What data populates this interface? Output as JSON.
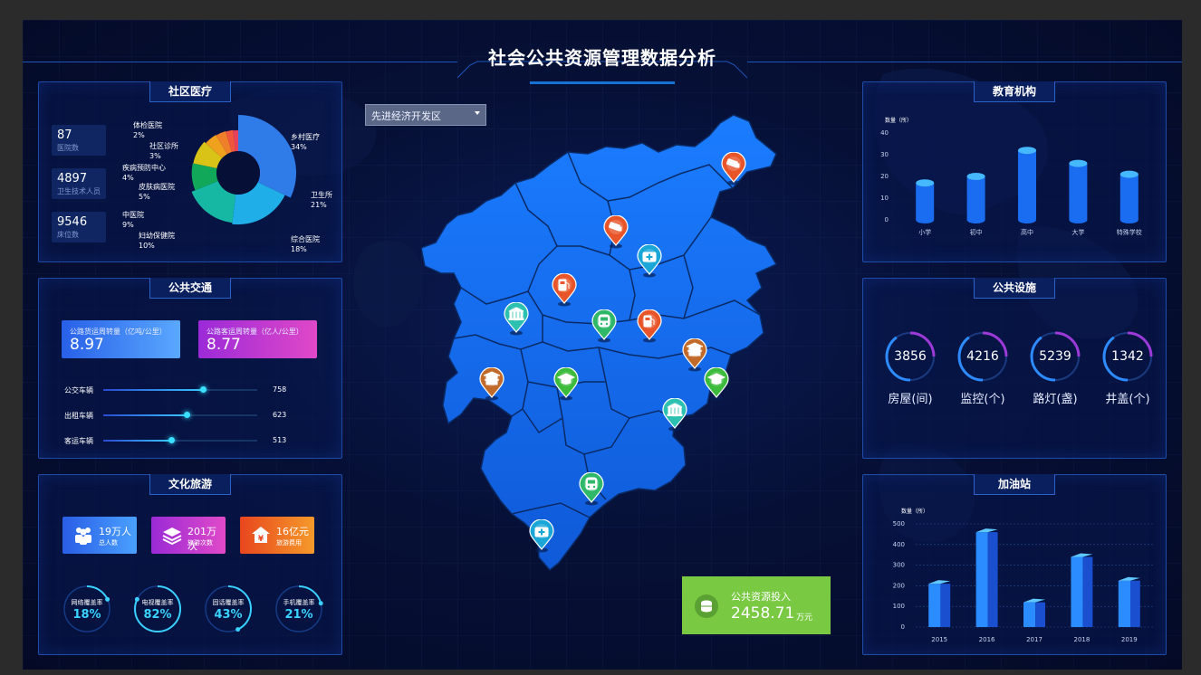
{
  "header": {
    "title": "社会公共资源管理数据分析"
  },
  "community_medical": {
    "title": "社区医疗",
    "stats": [
      {
        "value": "87",
        "label": "医院数"
      },
      {
        "value": "4897",
        "label": "卫生技术人员"
      },
      {
        "value": "9546",
        "label": "床位数"
      }
    ],
    "chart_data": {
      "type": "pie",
      "categories": [
        "乡村医疗",
        "卫生所",
        "综合医院",
        "妇幼保健院",
        "中医院",
        "皮肤病医院",
        "疾病预防中心",
        "社区诊所",
        "体检医院"
      ],
      "values": [
        34,
        21,
        18,
        10,
        9,
        5,
        4,
        3,
        2
      ],
      "labels": [
        "34%",
        "21%",
        "18%",
        "10%",
        "9%",
        "5%",
        "4%",
        "3%",
        "2%"
      ],
      "colors": [
        "#2f7be8",
        "#1faee8",
        "#16b8a4",
        "#12a85a",
        "#d8c316",
        "#f0a11d",
        "#f07f2a",
        "#f0553e",
        "#e8415e"
      ]
    }
  },
  "public_transport": {
    "title": "公共交通",
    "cards": [
      {
        "label": "公路货运周转量（亿吨/公里）",
        "value": "8.97"
      },
      {
        "label": "公路客运周转量（亿人/公里）",
        "value": "8.77"
      }
    ],
    "bars": [
      {
        "label": "公交车辆",
        "value": 758,
        "display": "758",
        "fraction": 0.65
      },
      {
        "label": "出租车辆",
        "value": 623,
        "display": "623",
        "fraction": 0.54
      },
      {
        "label": "客运车辆",
        "value": 513,
        "display": "513",
        "fraction": 0.44
      }
    ]
  },
  "culture_tourism": {
    "title": "文化旅游",
    "cards": [
      {
        "value": "19万人",
        "label": "总人数",
        "icon": "people-icon"
      },
      {
        "value": "201万次",
        "label": "旅游次数",
        "icon": "layers-icon"
      },
      {
        "value": "16亿元",
        "label": "旅游费用",
        "icon": "yuan-house-icon"
      }
    ],
    "rings": [
      {
        "label": "网络覆盖率",
        "percent": "18%",
        "value": 0.18
      },
      {
        "label": "电视覆盖率",
        "percent": "82%",
        "value": 0.82
      },
      {
        "label": "固话覆盖率",
        "percent": "43%",
        "value": 0.43
      },
      {
        "label": "手机覆盖率",
        "percent": "21%",
        "value": 0.21
      }
    ]
  },
  "map": {
    "dropdown": {
      "selected": "先进经济开发区"
    },
    "pins": [
      {
        "icon": "camera-icon",
        "color": "#e8552a"
      },
      {
        "icon": "camera-icon",
        "color": "#e8552a"
      },
      {
        "icon": "medical-kit-icon",
        "color": "#1aa7d8"
      },
      {
        "icon": "gas-station-icon",
        "color": "#e8552a"
      },
      {
        "icon": "bank-icon",
        "color": "#2bc0b0"
      },
      {
        "icon": "train-icon",
        "color": "#2fb86a"
      },
      {
        "icon": "gas-station-icon",
        "color": "#e8552a"
      },
      {
        "icon": "temple-icon",
        "color": "#c26a2a"
      },
      {
        "icon": "temple-icon",
        "color": "#c26a2a"
      },
      {
        "icon": "graduation-cap-icon",
        "color": "#3dbb3d"
      },
      {
        "icon": "graduation-cap-icon",
        "color": "#3dbb3d"
      },
      {
        "icon": "bank-icon",
        "color": "#2bc0b0"
      },
      {
        "icon": "train-icon",
        "color": "#2fb86a"
      },
      {
        "icon": "medical-kit-icon",
        "color": "#1aa7d8"
      }
    ],
    "investment": {
      "label": "公共资源投入",
      "value": "2458.71",
      "unit": "万元"
    }
  },
  "education": {
    "title": "教育机构",
    "chart_data": {
      "type": "bar",
      "ylabel": "数量（所）",
      "categories": [
        "小学",
        "初中",
        "高中",
        "大学",
        "特殊学校"
      ],
      "values": [
        17,
        20,
        32,
        26,
        21
      ],
      "ylim": [
        0,
        40
      ],
      "yticks": [
        "40",
        "30",
        "20",
        "10",
        "0"
      ]
    }
  },
  "public_facilities": {
    "title": "公共设施",
    "items": [
      {
        "value": "3856",
        "label": "房屋(间)"
      },
      {
        "value": "4216",
        "label": "监控(个)"
      },
      {
        "value": "5239",
        "label": "路灯(盏)"
      },
      {
        "value": "1342",
        "label": "井盖(个)"
      }
    ]
  },
  "gas_station": {
    "title": "加油站",
    "chart_data": {
      "type": "bar",
      "ylabel": "数量（所）",
      "categories": [
        "2015",
        "2016",
        "2017",
        "2018",
        "2019"
      ],
      "values": [
        210,
        460,
        120,
        340,
        225
      ],
      "ylim": [
        0,
        500
      ],
      "yticks": [
        "500",
        "400",
        "300",
        "200",
        "100",
        "0"
      ]
    }
  }
}
